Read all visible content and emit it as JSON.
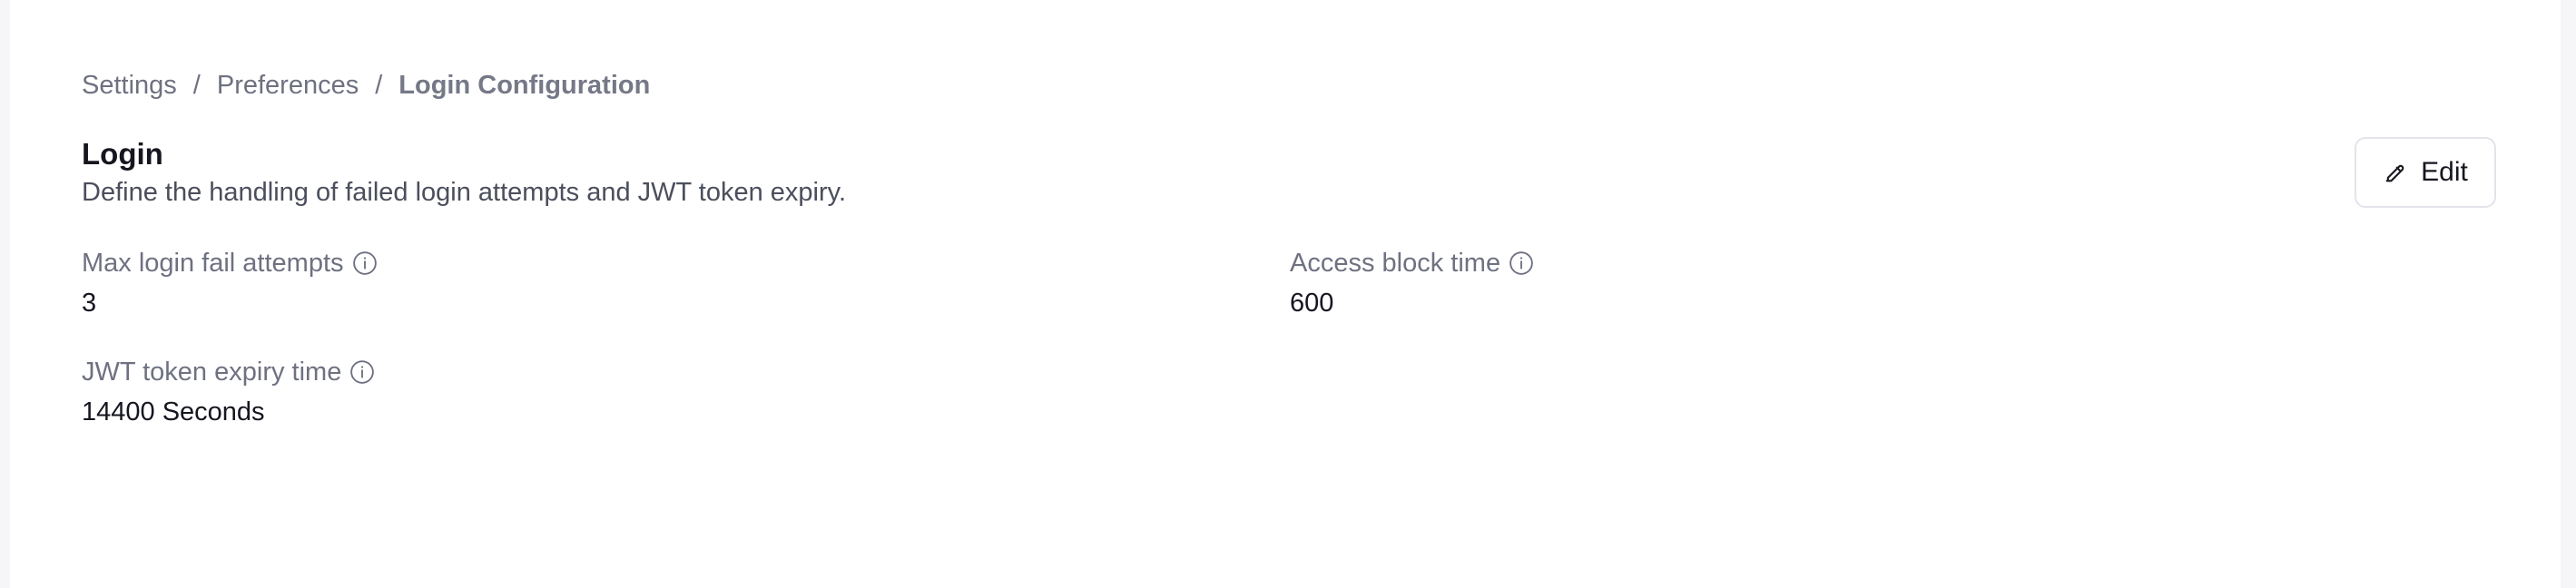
{
  "breadcrumb": {
    "items": [
      "Settings",
      "Preferences",
      "Login Configuration"
    ],
    "separator": "/"
  },
  "section": {
    "title": "Login",
    "description": "Define the handling of failed login attempts and JWT token expiry."
  },
  "actions": {
    "edit_label": "Edit",
    "edit_icon": "pencil-icon"
  },
  "fields": [
    {
      "label": "Max login fail attempts",
      "value": "3",
      "icon": "info-icon"
    },
    {
      "label": "Access block time",
      "value": "600",
      "icon": "info-icon"
    },
    {
      "label": "JWT token expiry time",
      "value": "14400 Seconds",
      "icon": "info-icon"
    }
  ],
  "colors": {
    "page_bg": "#f6f6f8",
    "panel_bg": "#ffffff",
    "muted_text": "#6e7180",
    "primary_text": "#15161f",
    "border": "#e3e4ea"
  }
}
